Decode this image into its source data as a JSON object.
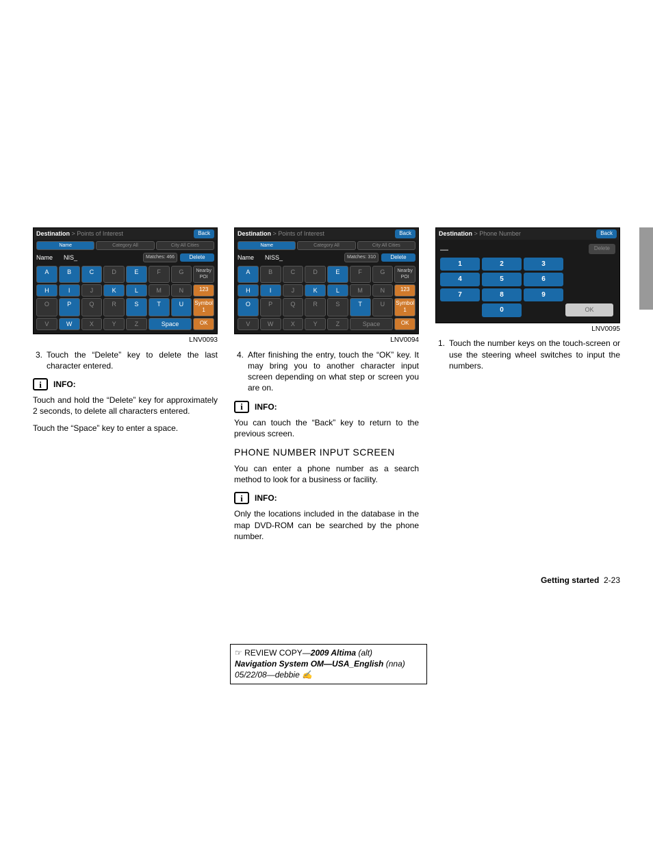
{
  "screen1": {
    "title_main": "Destination",
    "title_sub": "Points of Interest",
    "back": "Back",
    "tabs": [
      "Name",
      "Category All",
      "City All Cities"
    ],
    "name_label": "Name",
    "name_value": "NIS_",
    "matches_label": "Matches: 466",
    "delete": "Delete",
    "nearby": "Nearby POI",
    "btn123": "123",
    "symbol": "Symbol 1",
    "space": "Space",
    "ok": "OK",
    "fig_id": "LNV0093"
  },
  "screen2": {
    "title_main": "Destination",
    "title_sub": "Points of Interest",
    "back": "Back",
    "tabs": [
      "Name",
      "Category All",
      "City All Cities"
    ],
    "name_label": "Name",
    "name_value": "NISS_",
    "matches_label": "Matches: 310",
    "delete": "Delete",
    "nearby": "Nearby POI",
    "btn123": "123",
    "symbol": "Symbol 1",
    "space": "Space",
    "ok": "OK",
    "fig_id": "LNV0094"
  },
  "screen3": {
    "title_main": "Destination",
    "title_sub": "Phone Number",
    "back": "Back",
    "input": "—",
    "delete": "Delete",
    "keys": [
      "1",
      "2",
      "3",
      "4",
      "5",
      "6",
      "7",
      "8",
      "9",
      "0"
    ],
    "ok": "OK",
    "fig_id": "LNV0095"
  },
  "col1": {
    "step_num": "3.",
    "step_text": "Touch the “Delete” key to delete the last character entered.",
    "info": "INFO:",
    "p1": "Touch and hold the “Delete” key for approximately 2 seconds, to delete all characters entered.",
    "p2": "Touch the “Space” key to enter a space."
  },
  "col2": {
    "step_num": "4.",
    "step_text": "After finishing the entry, touch the “OK” key. It may bring you to another character input screen depending on what step or screen you are on.",
    "info1": "INFO:",
    "p1": "You can touch the “Back” key to return to the previous screen.",
    "heading": "PHONE NUMBER INPUT SCREEN",
    "p2": "You can enter a phone number as a search method to look for a business or facility.",
    "info2": "INFO:",
    "p3": "Only the locations included in the database in the map DVD-ROM can be searched by the phone number."
  },
  "col3": {
    "step_num": "1.",
    "step_text": "Touch the number keys on the touch-screen or use the steering wheel switches to input the numbers."
  },
  "footer": {
    "label": "Getting started",
    "page": "2-23"
  },
  "review": {
    "l1a": "☞ REVIEW COPY—",
    "l1b": "2009 Altima",
    "l1c": " (alt)",
    "l2a": "Navigation System OM—USA_English",
    "l2b": " (nna)",
    "l3": "05/22/08—debbie ✍"
  }
}
